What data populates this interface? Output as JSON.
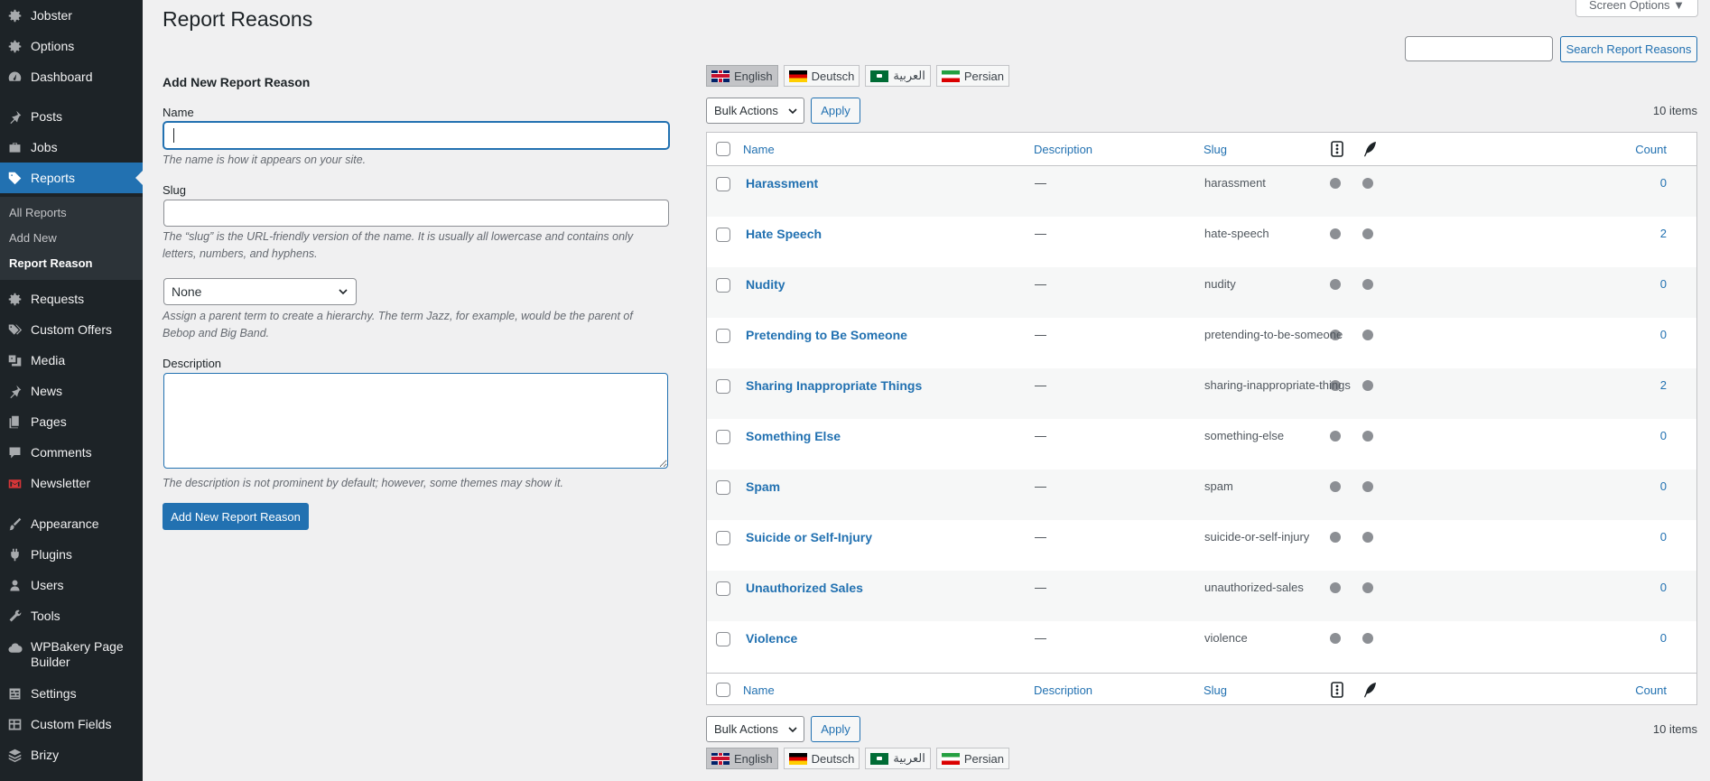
{
  "sidebar": {
    "items": [
      {
        "label": "Jobster",
        "icon": "gear-icon"
      },
      {
        "label": "Options",
        "icon": "gear-icon"
      },
      {
        "label": "Dashboard",
        "icon": "dashboard-icon"
      },
      {
        "label": "Posts",
        "icon": "pin-icon"
      },
      {
        "label": "Jobs",
        "icon": "briefcase-icon"
      },
      {
        "label": "Reports",
        "icon": "tag-icon"
      },
      {
        "label": "Requests",
        "icon": "gear-icon"
      },
      {
        "label": "Custom Offers",
        "icon": "tags-icon"
      },
      {
        "label": "Media",
        "icon": "media-icon"
      },
      {
        "label": "News",
        "icon": "pin-icon"
      },
      {
        "label": "Pages",
        "icon": "pages-icon"
      },
      {
        "label": "Comments",
        "icon": "comment-icon"
      },
      {
        "label": "Newsletter",
        "icon": "mail-icon"
      },
      {
        "label": "Appearance",
        "icon": "brush-icon"
      },
      {
        "label": "Plugins",
        "icon": "plugin-icon"
      },
      {
        "label": "Users",
        "icon": "user-icon"
      },
      {
        "label": "Tools",
        "icon": "wrench-icon"
      },
      {
        "label": "WPBakery Page",
        "label2": "Builder",
        "icon": "cloud-icon"
      },
      {
        "label": "Settings",
        "icon": "settings-icon"
      },
      {
        "label": "Custom Fields",
        "icon": "grid-icon"
      },
      {
        "label": "Brizy",
        "icon": "layers-icon"
      }
    ],
    "submenu": [
      "All Reports",
      "Add New",
      "Report Reason"
    ]
  },
  "header": {
    "title": "Report Reasons",
    "screen_options": "Screen Options ▼",
    "search_button": "Search Report Reasons",
    "search_value": ""
  },
  "form": {
    "heading": "Add New Report Reason",
    "name_label": "Name",
    "name_help": "The name is how it appears on your site.",
    "slug_label": "Slug",
    "slug_help": "The “slug” is the URL-friendly version of the name. It is usually all lowercase and contains only letters, numbers, and hyphens.",
    "parent_value": "None",
    "parent_help": "Assign a parent term to create a hierarchy. The term Jazz, for example, would be the parent of Bebop and Big Band.",
    "description_label": "Description",
    "description_help": "The description is not prominent by default; however, some themes may show it.",
    "submit_label": "Add New Report Reason"
  },
  "languages": [
    {
      "label": "English",
      "flag": "uk-flag",
      "active": true
    },
    {
      "label": "Deutsch",
      "flag": "de-flag",
      "active": false
    },
    {
      "label": "العربية",
      "flag": "sa-flag",
      "active": false
    },
    {
      "label": "Persian",
      "flag": "ir-flag",
      "active": false
    }
  ],
  "actions": {
    "bulk_label": "Bulk Actions",
    "apply_label": "Apply",
    "items_count": "10 items"
  },
  "table": {
    "columns": {
      "name": "Name",
      "description": "Description",
      "slug": "Slug",
      "count": "Count"
    },
    "rows": [
      {
        "name": "Harassment",
        "description": "—",
        "slug": "harassment",
        "count": "0"
      },
      {
        "name": "Hate Speech",
        "description": "—",
        "slug": "hate-speech",
        "count": "2"
      },
      {
        "name": "Nudity",
        "description": "—",
        "slug": "nudity",
        "count": "0"
      },
      {
        "name": "Pretending to Be Someone",
        "description": "—",
        "slug": "pretending-to-be-someone",
        "count": "0"
      },
      {
        "name": "Sharing Inappropriate Things",
        "description": "—",
        "slug": "sharing-inappropriate-things",
        "count": "2"
      },
      {
        "name": "Something Else",
        "description": "—",
        "slug": "something-else",
        "count": "0"
      },
      {
        "name": "Spam",
        "description": "—",
        "slug": "spam",
        "count": "0"
      },
      {
        "name": "Suicide or Self-Injury",
        "description": "—",
        "slug": "suicide-or-self-injury",
        "count": "0"
      },
      {
        "name": "Unauthorized Sales",
        "description": "—",
        "slug": "unauthorized-sales",
        "count": "0"
      },
      {
        "name": "Violence",
        "description": "—",
        "slug": "violence",
        "count": "0"
      }
    ]
  },
  "colors": {
    "accent": "#2271b1",
    "sidebar_bg": "#1d2327",
    "active_menu": "#2271b1"
  }
}
